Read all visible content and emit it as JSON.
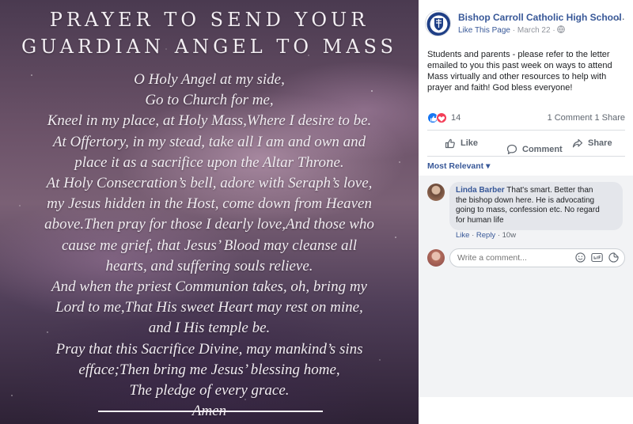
{
  "image": {
    "title_lines": [
      "PRAYER TO SEND YOUR",
      "GUARDIAN ANGEL TO MASS"
    ],
    "prayer_lines": [
      "O Holy Angel at my side,",
      "Go to Church for me,",
      "Kneel in my place, at Holy Mass,Where I desire to be.",
      "At Offertory, in my stead, take all I am and own and",
      "place it as a sacrifice upon the Altar Throne.",
      "At Holy Consecration’s bell, adore with Seraph’s love,",
      "my Jesus hidden in the Host, come down from Heaven",
      "above.Then pray for those I dearly love,And those who",
      "cause me grief, that Jesus’ Blood may cleanse all",
      "hearts, and suffering souls relieve.",
      "And when the priest Communion takes, oh, bring my",
      "Lord to me,That His sweet Heart may rest on mine,",
      "and I His temple be.",
      "Pray that this Sacrifice Divine, may mankind’s sins",
      "efface;Then bring me Jesus’ blessing home,",
      "The pledge of every grace.",
      "Amen"
    ]
  },
  "post": {
    "page_name": "Bishop Carroll Catholic High School",
    "like_page": "Like This Page",
    "separator": " · ",
    "date": "March 22",
    "separator2": " · ",
    "menu": "···",
    "text_lines": [
      "Students and parents - please refer to the letter",
      "emailed to you this past week on ways to attend",
      "Mass virtually and other resources to help with",
      "prayer and faith! God bless everyone!"
    ],
    "reaction_count": "14",
    "comment_share": "1 Comment 1 Share",
    "actions": {
      "like": "Like",
      "comment": "Comment",
      "share": "Share"
    },
    "sort_label": "Most Relevant ▾",
    "comment": {
      "author": "Linda Barber",
      "text_first": " That's smart. Better than",
      "text_lines": [
        "the bishop down here. He is advocating",
        "going to mass, confession etc. No regard",
        "for human life"
      ],
      "like": "Like",
      "dot": " · ",
      "reply": "Reply",
      "dot2": " · ",
      "age": "10w"
    },
    "composer_placeholder": "Write a comment..."
  },
  "colors": {
    "link_blue": "#385898",
    "like_blue": "#1877f2",
    "love_red": "#f33e58",
    "muted": "#606770"
  },
  "icons": {
    "globe": "globe-icon",
    "like": "thumbs-up-icon",
    "comment": "speech-bubble-icon",
    "share": "share-arrow-icon",
    "emoji": "smiley-icon",
    "gif": "gif-icon",
    "sticker": "sticker-icon"
  }
}
